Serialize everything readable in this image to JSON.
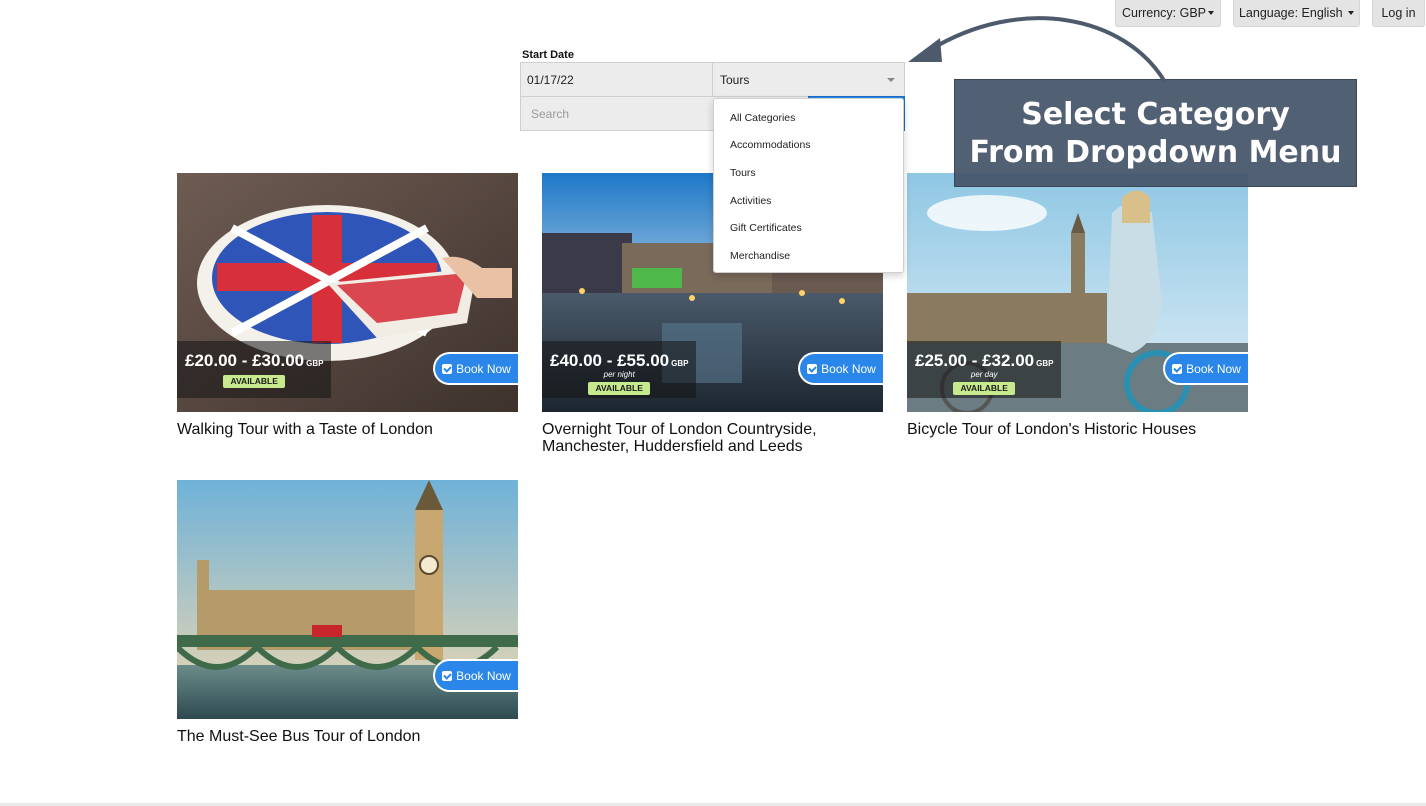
{
  "header": {
    "currency_label": "Currency: GBP",
    "language_label": "Language: English",
    "login_label": "Log in"
  },
  "filters": {
    "start_date_label": "Start Date",
    "start_date_value": "01/17/22",
    "category_value": "Tours",
    "search_placeholder": "Search",
    "category_options": [
      "All Categories",
      "Accommodations",
      "Tours",
      "Activities",
      "Gift Certificates",
      "Merchandise"
    ]
  },
  "callout": {
    "line1": "Select Category",
    "line2": "From Dropdown Menu"
  },
  "tours": [
    {
      "title": "Walking Tour with a Taste of London",
      "price": "£20.00 - £30.00",
      "currency": "GBP",
      "per": "",
      "status": "AVAILABLE",
      "button": "Book Now",
      "image": "union-jack-cake-photo"
    },
    {
      "title": "Overnight Tour of London Countryside, Manchester, Huddersfield and Leeds",
      "price": "£40.00 - £55.00",
      "currency": "GBP",
      "per": "per night",
      "status": "AVAILABLE",
      "button": "Book Now",
      "image": "city-square-night-photo"
    },
    {
      "title": "Bicycle Tour of London's Historic Houses",
      "price": "£25.00 - £32.00",
      "currency": "GBP",
      "per": "per day",
      "status": "AVAILABLE",
      "button": "Book Now",
      "image": "tourist-bicycle-big-ben-photo"
    },
    {
      "title": "The Must-See Bus Tour of London",
      "button": "Book Now",
      "image": "westminster-bridge-photo"
    }
  ],
  "colors": {
    "accent_blue": "#2a86e8",
    "available_badge": "#c6ea8d",
    "callout_bg": "#455468"
  }
}
